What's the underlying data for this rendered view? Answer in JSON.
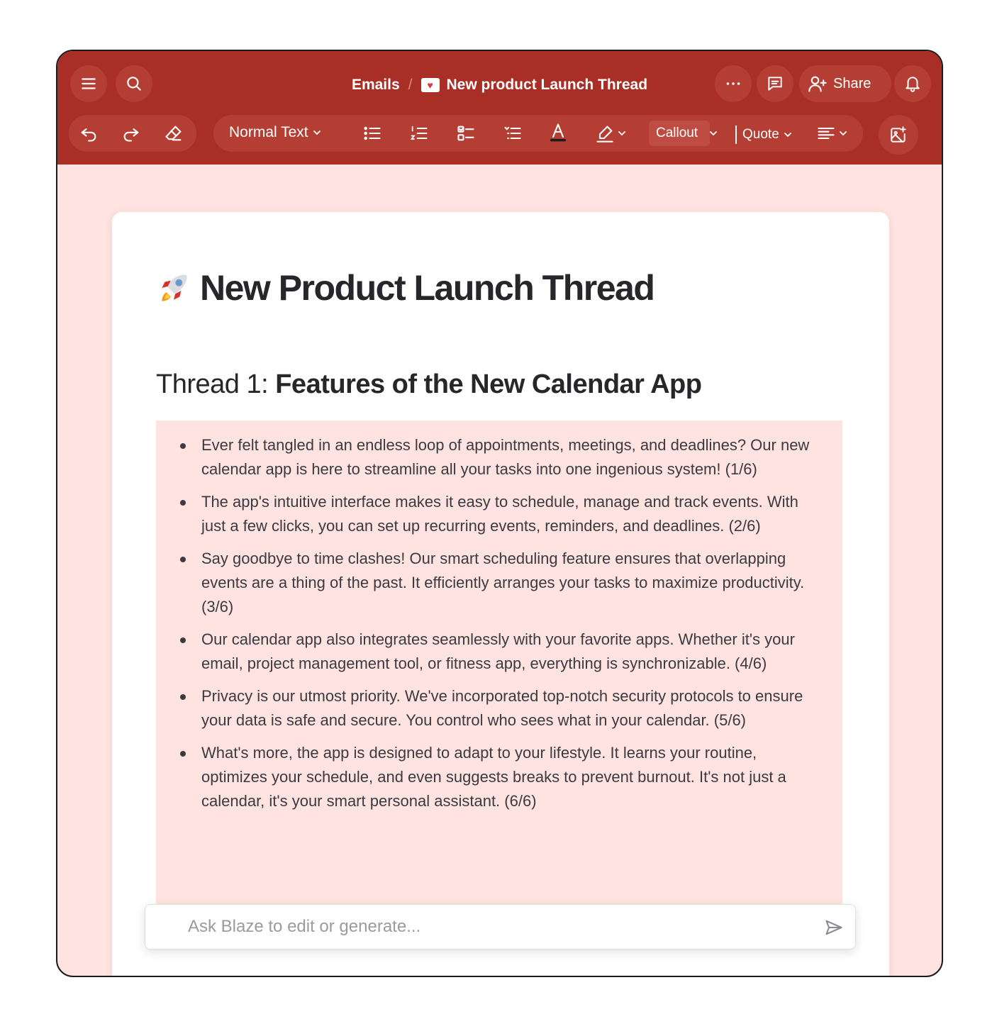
{
  "breadcrumb": {
    "parent": "Emails",
    "separator": "/",
    "current": "New product Launch Thread"
  },
  "header": {
    "share_label": "Share"
  },
  "toolbar": {
    "text_style": "Normal Text",
    "callout_label": "Callout",
    "quote_label": "Quote"
  },
  "document": {
    "title": "New Product Launch Thread",
    "thread_prefix": "Thread 1: ",
    "thread_title": "Features of the New Calendar App",
    "items": [
      "Ever felt tangled in an endless loop of appointments, meetings, and deadlines? Our new calendar app is here to streamline all your tasks into one ingenious system! (1/6)",
      "The app's intuitive interface makes it easy to schedule, manage and track events. With just a few clicks, you can set up recurring events, reminders, and deadlines. (2/6)",
      "Say goodbye to time clashes! Our smart scheduling feature ensures that overlapping events are a thing of the past. It efficiently arranges your tasks to maximize productivity. (3/6)",
      "Our calendar app also integrates seamlessly with your favorite apps. Whether it's your email, project management tool, or fitness app, everything is synchronizable. (4/6)",
      "Privacy is our utmost priority. We've incorporated top-notch security protocols to ensure your data is safe and secure. You control who sees what in your calendar. (5/6)",
      "What's more, the app is designed to adapt to your lifestyle. It learns your routine, optimizes your schedule, and even suggests breaks to prevent burnout. It's not just a calendar, it's your smart personal assistant. (6/6)"
    ]
  },
  "ask": {
    "placeholder": "Ask Blaze to edit or generate...",
    "value": ""
  },
  "colors": {
    "topbar": "#a92f26",
    "button_bg": "#b43e34",
    "canvas": "#ffe3e1",
    "callout_bg": "#ffe3e1",
    "text": "#26262b"
  }
}
